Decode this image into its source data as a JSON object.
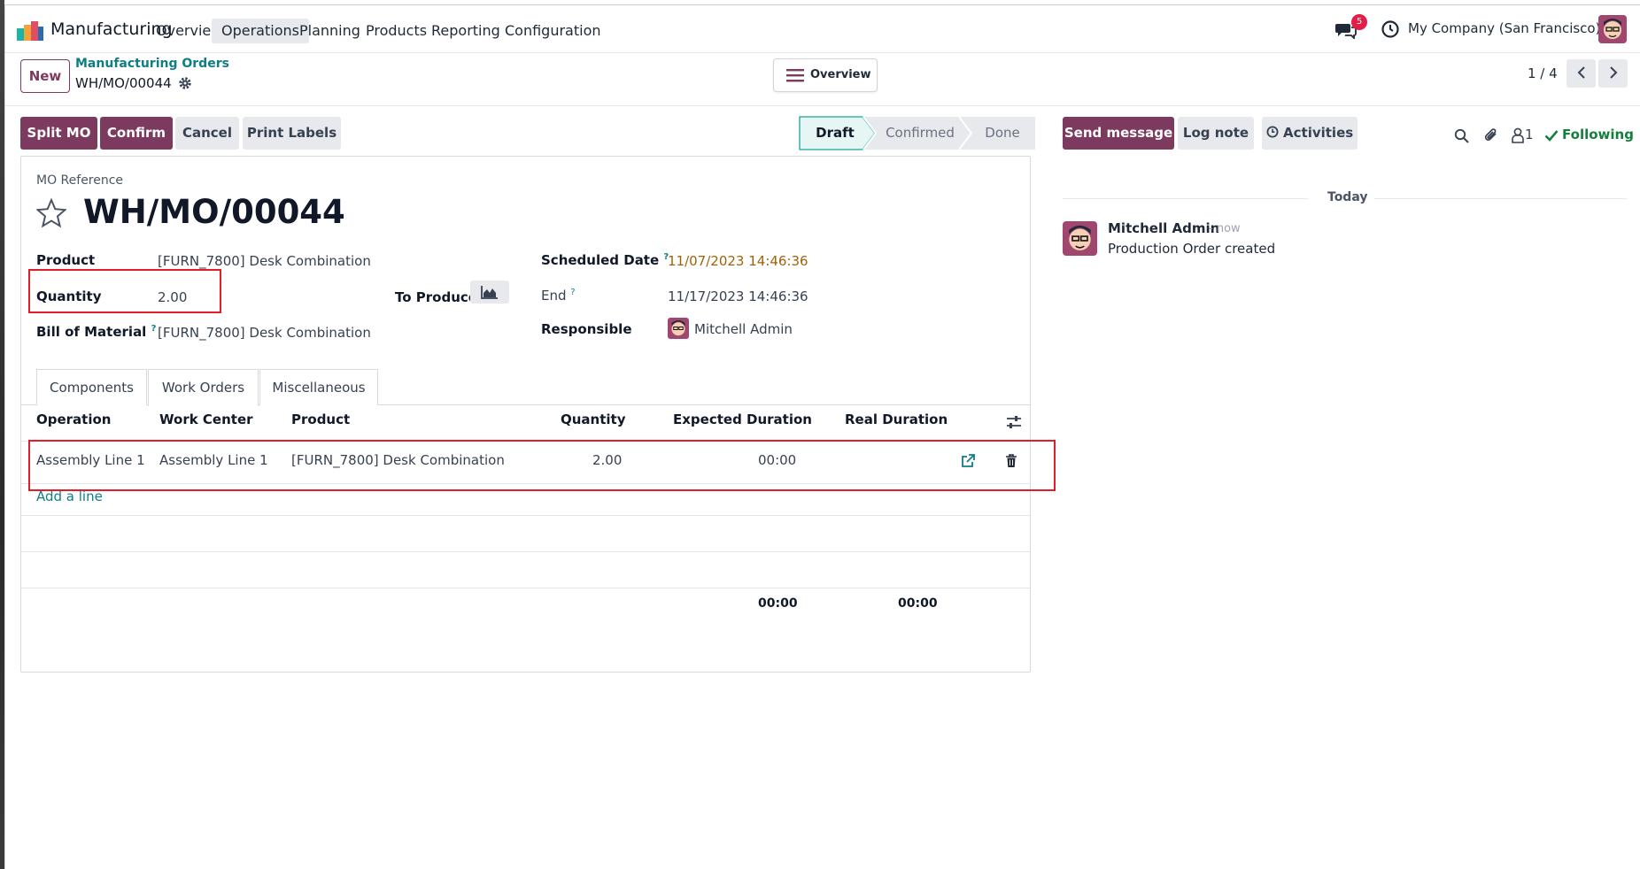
{
  "nav": {
    "app_name": "Manufacturing",
    "menus": [
      "Overview",
      "Operations",
      "Planning",
      "Products",
      "Reporting",
      "Configuration"
    ],
    "active_menu": "Operations",
    "notification_count": "5",
    "company": "My Company (San Francisco)"
  },
  "control_panel": {
    "new_label": "New",
    "breadcrumb_parent": "Manufacturing Orders",
    "breadcrumb_current": "WH/MO/00044",
    "overview_label": "Overview",
    "pager": "1 / 4"
  },
  "actions": {
    "split_mo": "Split MO",
    "confirm": "Confirm",
    "cancel": "Cancel",
    "print_labels": "Print Labels"
  },
  "statusbar": {
    "stages": [
      "Draft",
      "Confirmed",
      "Done"
    ],
    "current": "Draft"
  },
  "form": {
    "ref_label": "MO Reference",
    "ref_value": "WH/MO/00044",
    "product_label": "Product",
    "product_value": "[FURN_7800] Desk Combination",
    "quantity_label": "Quantity",
    "quantity_value": "2.00",
    "to_produce_label": "To Produce",
    "bom_label": "Bill of Material",
    "bom_value": "[FURN_7800] Desk Combination",
    "scheduled_label": "Scheduled Date",
    "scheduled_value": "11/07/2023 14:46:36",
    "end_label": "End",
    "end_value": "11/17/2023 14:46:36",
    "responsible_label": "Responsible",
    "responsible_value": "Mitchell Admin",
    "help_mark": "?"
  },
  "tabs": [
    "Components",
    "Work Orders",
    "Miscellaneous"
  ],
  "active_tab": "Work Orders",
  "work_orders": {
    "columns": [
      "Operation",
      "Work Center",
      "Product",
      "Quantity",
      "Expected Duration",
      "Real Duration"
    ],
    "rows": [
      {
        "operation": "Assembly Line 1",
        "work_center": "Assembly Line 1",
        "product": "[FURN_7800] Desk Combination",
        "quantity": "2.00",
        "expected": "00:00",
        "real": ""
      }
    ],
    "add_line": "Add a line",
    "total_expected": "00:00",
    "total_real": "00:00"
  },
  "chatter": {
    "send_message": "Send message",
    "log_note": "Log note",
    "activities": "Activities",
    "followers_count": "1",
    "following": "Following",
    "date_separator": "Today",
    "messages": [
      {
        "author": "Mitchell Admin",
        "time": "- now",
        "body": "Production Order created"
      }
    ]
  },
  "colors": {
    "primary": "#7c3a5e",
    "link": "#0f7d86",
    "scheduled_warning": "#a16207",
    "following": "#15803d",
    "highlight_box": "#e11d2a"
  }
}
